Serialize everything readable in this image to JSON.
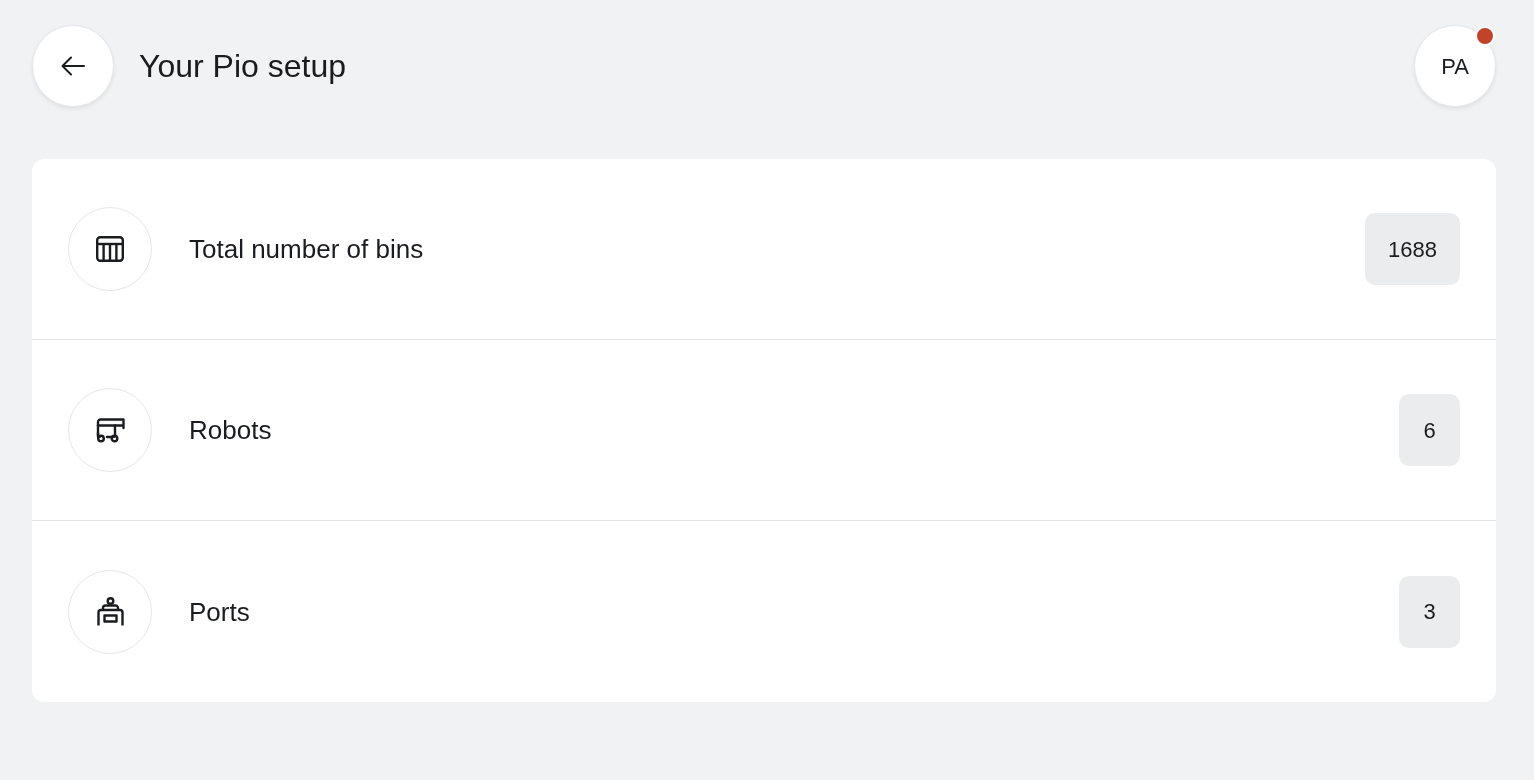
{
  "header": {
    "title": "Your Pio setup",
    "avatar": {
      "initials": "PA",
      "notification": true
    }
  },
  "setup_items": [
    {
      "label": "Total number of bins",
      "value": "1688"
    },
    {
      "label": "Robots",
      "value": "6"
    },
    {
      "label": "Ports",
      "value": "3"
    }
  ]
}
